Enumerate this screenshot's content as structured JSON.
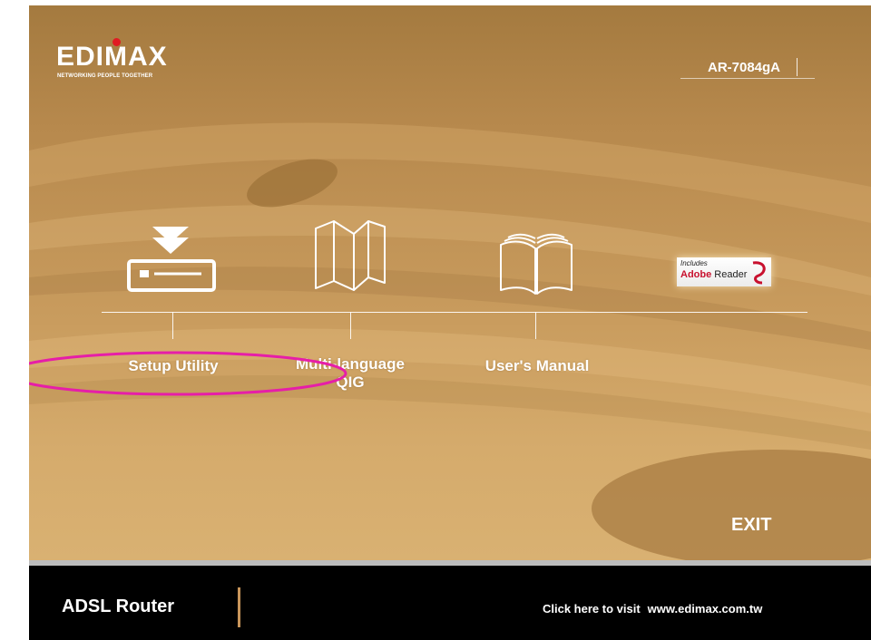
{
  "brand": {
    "logo_text": "EDIMAX",
    "tagline": "NETWORKING PEOPLE TOGETHER",
    "accent_dot_color": "#e11b22"
  },
  "header": {
    "model": "AR-7084gA"
  },
  "menu": {
    "items": [
      {
        "label": "Setup Utility",
        "icon": "install-tray-icon"
      },
      {
        "label_line1": "Multi-language",
        "label_line2": "QIG",
        "icon": "folded-map-icon"
      },
      {
        "label": "User's Manual",
        "icon": "open-book-icon"
      }
    ],
    "adobe": {
      "includes": "Includes",
      "brand": "Adobe",
      "product": "Reader"
    }
  },
  "exit_label": "EXIT",
  "footer": {
    "product_name": "ADSL Router",
    "visit_text": "Click here to visit",
    "url": "www.edimax.com.tw"
  },
  "colors": {
    "background": "#c89b5d",
    "footer": "#000000",
    "highlight": "#e61ea8",
    "divider": "#c8955a"
  }
}
